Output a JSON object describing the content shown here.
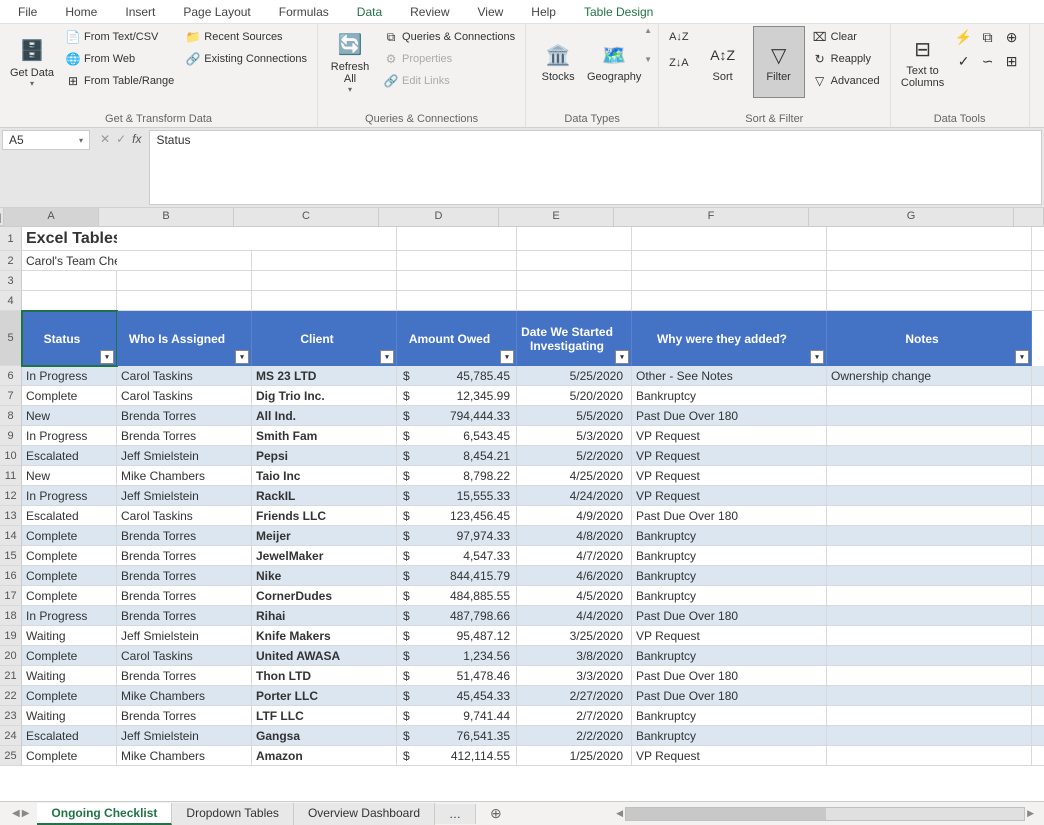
{
  "menus": [
    "File",
    "Home",
    "Insert",
    "Page Layout",
    "Formulas",
    "Data",
    "Review",
    "View",
    "Help",
    "Table Design"
  ],
  "active_menu": "Data",
  "ribbon": {
    "get_data": {
      "label": "Get & Transform Data",
      "main": "Get Data",
      "items": [
        "From Text/CSV",
        "From Web",
        "From Table/Range",
        "Recent Sources",
        "Existing Connections"
      ]
    },
    "queries": {
      "label": "Queries & Connections",
      "main": "Refresh All",
      "items": [
        "Queries & Connections",
        "Properties",
        "Edit Links"
      ]
    },
    "datatypes": {
      "label": "Data Types",
      "items": [
        "Stocks",
        "Geography"
      ]
    },
    "sortfilter": {
      "label": "Sort & Filter",
      "sort": "Sort",
      "filter": "Filter",
      "side": [
        "Clear",
        "Reapply",
        "Advanced"
      ]
    },
    "datatools": {
      "label": "Data Tools",
      "main": "Text to Columns"
    }
  },
  "namebox": "A5",
  "formula": "Status",
  "colheaders": [
    "A",
    "B",
    "C",
    "D",
    "E",
    "F",
    "G"
  ],
  "title": "Excel Tables and Dropdowns Demo",
  "subtitle": "Carol's Team Checklist",
  "table_headers": [
    "Status",
    "Who Is Assigned",
    "Client",
    "Amount Owed",
    "Date We Started Investigating",
    "Why were they added?",
    "Notes"
  ],
  "rows": [
    {
      "n": 6,
      "status": "In Progress",
      "who": "Carol Taskins",
      "client": "MS 23 LTD",
      "amt": "45,785.45",
      "date": "5/25/2020",
      "why": "Other - See Notes",
      "notes": "Ownership change"
    },
    {
      "n": 7,
      "status": "Complete",
      "who": "Carol Taskins",
      "client": "Dig Trio Inc.",
      "amt": "12,345.99",
      "date": "5/20/2020",
      "why": "Bankruptcy",
      "notes": ""
    },
    {
      "n": 8,
      "status": "New",
      "who": "Brenda Torres",
      "client": "All Ind.",
      "amt": "794,444.33",
      "date": "5/5/2020",
      "why": "Past Due Over 180",
      "notes": ""
    },
    {
      "n": 9,
      "status": "In Progress",
      "who": "Brenda Torres",
      "client": "Smith Fam",
      "amt": "6,543.45",
      "date": "5/3/2020",
      "why": "VP Request",
      "notes": ""
    },
    {
      "n": 10,
      "status": "Escalated",
      "who": "Jeff Smielstein",
      "client": "Pepsi",
      "amt": "8,454.21",
      "date": "5/2/2020",
      "why": "VP Request",
      "notes": ""
    },
    {
      "n": 11,
      "status": "New",
      "who": "Mike Chambers",
      "client": "Taio Inc",
      "amt": "8,798.22",
      "date": "4/25/2020",
      "why": "VP Request",
      "notes": ""
    },
    {
      "n": 12,
      "status": "In Progress",
      "who": "Jeff Smielstein",
      "client": "RackIL",
      "amt": "15,555.33",
      "date": "4/24/2020",
      "why": "VP Request",
      "notes": ""
    },
    {
      "n": 13,
      "status": "Escalated",
      "who": "Carol Taskins",
      "client": "Friends LLC",
      "amt": "123,456.45",
      "date": "4/9/2020",
      "why": "Past Due Over 180",
      "notes": ""
    },
    {
      "n": 14,
      "status": "Complete",
      "who": "Brenda Torres",
      "client": "Meijer",
      "amt": "97,974.33",
      "date": "4/8/2020",
      "why": "Bankruptcy",
      "notes": ""
    },
    {
      "n": 15,
      "status": "Complete",
      "who": "Brenda Torres",
      "client": "JewelMaker",
      "amt": "4,547.33",
      "date": "4/7/2020",
      "why": "Bankruptcy",
      "notes": ""
    },
    {
      "n": 16,
      "status": "Complete",
      "who": "Brenda Torres",
      "client": "Nike",
      "amt": "844,415.79",
      "date": "4/6/2020",
      "why": "Bankruptcy",
      "notes": ""
    },
    {
      "n": 17,
      "status": "Complete",
      "who": "Brenda Torres",
      "client": "CornerDudes",
      "amt": "484,885.55",
      "date": "4/5/2020",
      "why": "Bankruptcy",
      "notes": ""
    },
    {
      "n": 18,
      "status": "In Progress",
      "who": "Brenda Torres",
      "client": "Rihai",
      "amt": "487,798.66",
      "date": "4/4/2020",
      "why": "Past Due Over 180",
      "notes": ""
    },
    {
      "n": 19,
      "status": "Waiting",
      "who": "Jeff Smielstein",
      "client": "Knife Makers",
      "amt": "95,487.12",
      "date": "3/25/2020",
      "why": "VP Request",
      "notes": ""
    },
    {
      "n": 20,
      "status": "Complete",
      "who": "Carol Taskins",
      "client": "United AWASA",
      "amt": "1,234.56",
      "date": "3/8/2020",
      "why": "Bankruptcy",
      "notes": ""
    },
    {
      "n": 21,
      "status": "Waiting",
      "who": "Brenda Torres",
      "client": "Thon LTD",
      "amt": "51,478.46",
      "date": "3/3/2020",
      "why": "Past Due Over 180",
      "notes": ""
    },
    {
      "n": 22,
      "status": "Complete",
      "who": "Mike Chambers",
      "client": "Porter LLC",
      "amt": "45,454.33",
      "date": "2/27/2020",
      "why": "Past Due Over 180",
      "notes": ""
    },
    {
      "n": 23,
      "status": "Waiting",
      "who": "Brenda Torres",
      "client": "LTF LLC",
      "amt": "9,741.44",
      "date": "2/7/2020",
      "why": "Bankruptcy",
      "notes": ""
    },
    {
      "n": 24,
      "status": "Escalated",
      "who": "Jeff Smielstein",
      "client": "Gangsa",
      "amt": "76,541.35",
      "date": "2/2/2020",
      "why": "Bankruptcy",
      "notes": ""
    },
    {
      "n": 25,
      "status": "Complete",
      "who": "Mike Chambers",
      "client": "Amazon",
      "amt": "412,114.55",
      "date": "1/25/2020",
      "why": "VP Request",
      "notes": ""
    }
  ],
  "sheets": [
    "Ongoing Checklist",
    "Dropdown Tables",
    "Overview Dashboard"
  ],
  "active_sheet": 0,
  "ellipsis": "…",
  "currency_symbol": "$"
}
